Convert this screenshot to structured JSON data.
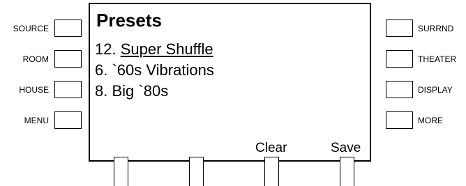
{
  "left_keys": [
    {
      "label": "SOURCE"
    },
    {
      "label": "ROOM"
    },
    {
      "label": "HOUSE"
    },
    {
      "label": "MENU"
    }
  ],
  "right_keys": [
    {
      "label": "SURRND"
    },
    {
      "label": "THEATER"
    },
    {
      "label": "DISPLAY"
    },
    {
      "label": "MORE"
    }
  ],
  "screen": {
    "title": "Presets",
    "presets": [
      {
        "number": "12.",
        "name": "Super Shuffle",
        "selected": true
      },
      {
        "number": "6.",
        "name": "`60s Vibrations",
        "selected": false
      },
      {
        "number": "8.",
        "name": "Big `80s",
        "selected": false
      }
    ],
    "softkeys": [
      "",
      "",
      "Clear",
      "Save"
    ]
  }
}
